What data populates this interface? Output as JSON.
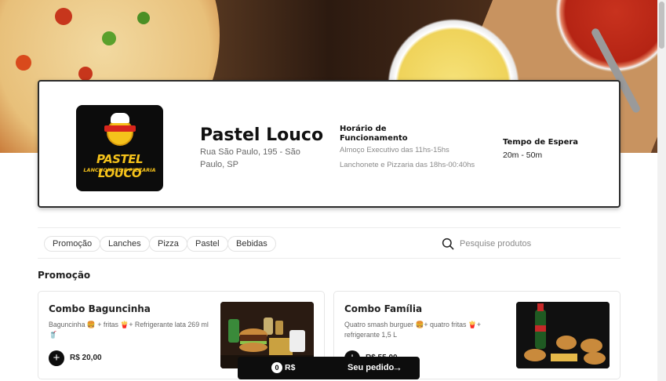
{
  "store": {
    "name": "Pastel Louco",
    "address": "Rua São Paulo, 195 - São Paulo, SP",
    "logo_text": "PASTEL LOUCO",
    "logo_subtext": "LANCHONETE E PIZZARIA",
    "hours_title": "Horário de Funcionamento",
    "hours_lines": [
      "Almoço Executivo das 11hs-15hs",
      "Lanchonete e Pizzaria das 18hs-00:40hs"
    ],
    "wait_title": "Tempo de Espera",
    "wait_value": "20m - 50m"
  },
  "categories": [
    "Promoção",
    "Lanches",
    "Pizza",
    "Pastel",
    "Bebidas"
  ],
  "search": {
    "placeholder": "Pesquise produtos",
    "icon": "search-icon"
  },
  "section": {
    "title": "Promoção"
  },
  "products": [
    {
      "name": "Combo Baguncinha",
      "description": "Baguncinha 🍔 + fritas 🍟+ Refrigerante lata 269 ml 🥤",
      "price": "R$ 20,00",
      "add_label": "+"
    },
    {
      "name": "Combo Família",
      "description": "Quatro smash burguer 🍔+ quatro fritas 🍟+ refrigerante 1,5 L",
      "price": "R$ 55,00",
      "add_label": "+"
    }
  ],
  "order": {
    "count": "0",
    "currency": "R$",
    "label": "Seu pedido",
    "arrow": "→"
  },
  "colors": {
    "accent": "#0d0d0d",
    "logo_yellow": "#f5c21b",
    "muted_text": "#8a8a8a"
  }
}
